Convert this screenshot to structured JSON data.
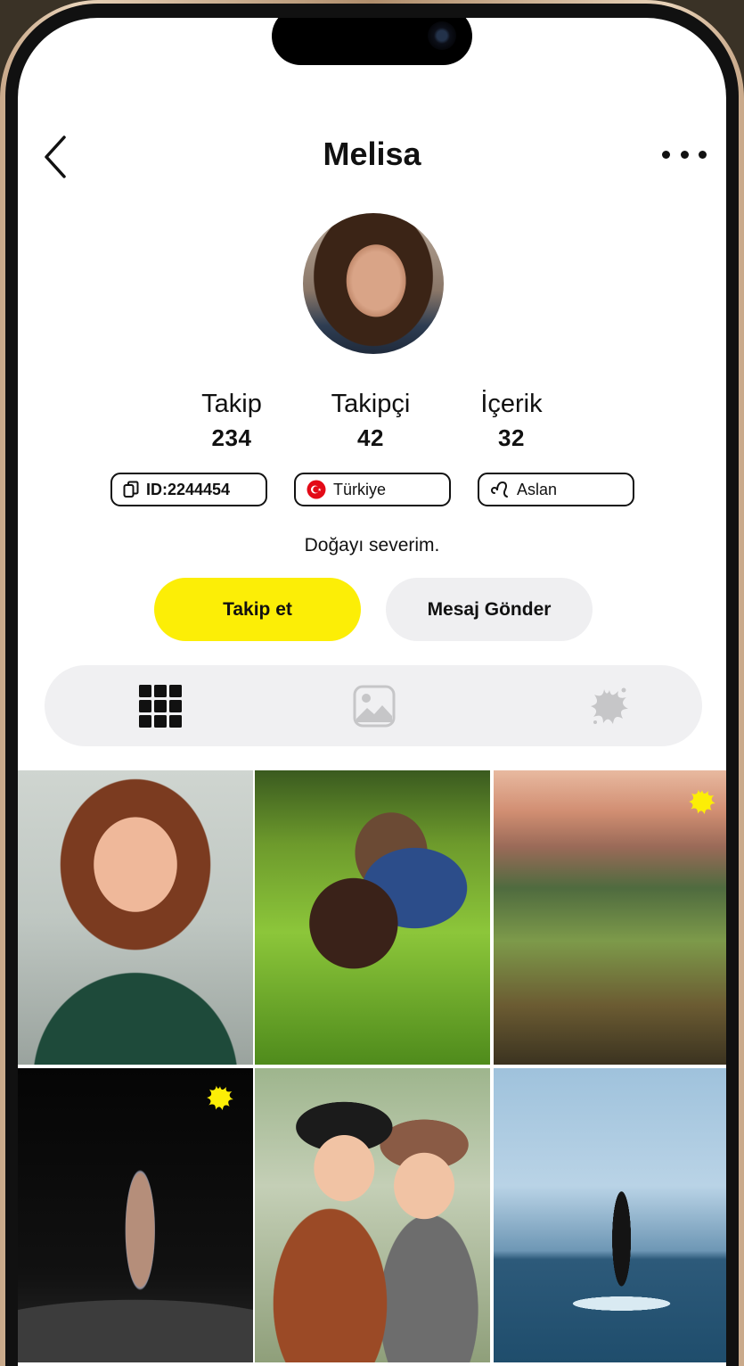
{
  "profile": {
    "name": "Melisa",
    "bio": "Doğayı severim."
  },
  "stats": [
    {
      "label": "Takip",
      "value": "234"
    },
    {
      "label": "Takipçi",
      "value": "42"
    },
    {
      "label": "İçerik",
      "value": "32"
    }
  ],
  "chips": {
    "id": "ID:2244454",
    "country": "Türkiye",
    "zodiac": "Aslan"
  },
  "actions": {
    "follow": "Takip et",
    "message": "Mesaj Gönder"
  },
  "colors": {
    "accent": "#fcee06",
    "secondary_button": "#efeff1",
    "tab_bar": "#f0f0f2"
  },
  "tabs": [
    {
      "icon": "grid-icon",
      "active": true
    },
    {
      "icon": "image-icon",
      "active": false
    },
    {
      "icon": "splash-icon",
      "active": false
    }
  ],
  "posts": [
    {
      "subject": "smiling-woman-photo",
      "badge": false
    },
    {
      "subject": "woman-with-dog-photo",
      "badge": false
    },
    {
      "subject": "mountain-village-photo",
      "badge": true
    },
    {
      "subject": "theater-stage-photo",
      "badge": true
    },
    {
      "subject": "two-women-selfie-photo",
      "badge": false
    },
    {
      "subject": "paddleboard-sea-photo",
      "badge": false
    }
  ]
}
